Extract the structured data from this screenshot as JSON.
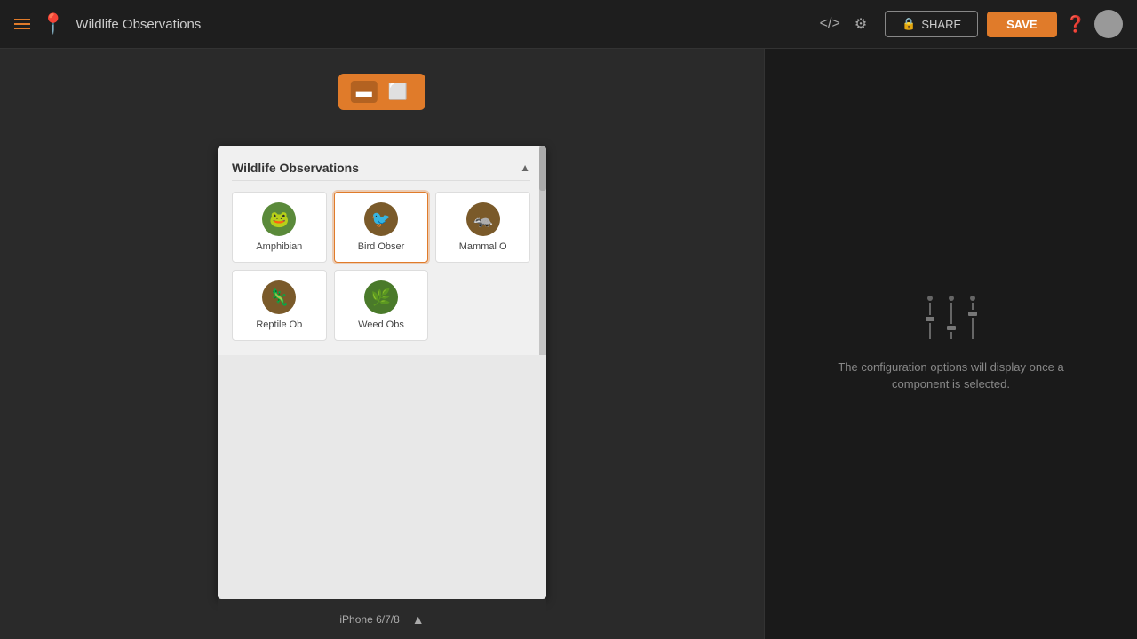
{
  "topbar": {
    "title": "Wildlife Observations",
    "code_icon": "</>",
    "settings_icon": "⚙",
    "share_label": "SHARE",
    "save_label": "SAVE",
    "help_icon": "?",
    "lock_icon": "🔒"
  },
  "toolbar": {
    "view_compact_icon": "▬",
    "view_grid_icon": "▭"
  },
  "widget": {
    "title": "Wildlife Observations",
    "items": [
      {
        "id": "amphibian",
        "label": "Amphibian",
        "icon": "🐸",
        "icon_class": "green"
      },
      {
        "id": "bird",
        "label": "Bird Obser",
        "icon": "🐦",
        "icon_class": "brown",
        "highlighted": true
      },
      {
        "id": "mammal",
        "label": "Mammal O",
        "icon": "🦡",
        "icon_class": "brown"
      },
      {
        "id": "reptile",
        "label": "Reptile Ob",
        "icon": "🦎",
        "icon_class": "brown"
      },
      {
        "id": "weed",
        "label": "Weed Obs",
        "icon": "🌿",
        "icon_class": "green2"
      }
    ]
  },
  "device": {
    "name": "iPhone 6/7/8"
  },
  "config_panel": {
    "message": "The configuration options will display once a component is selected."
  }
}
